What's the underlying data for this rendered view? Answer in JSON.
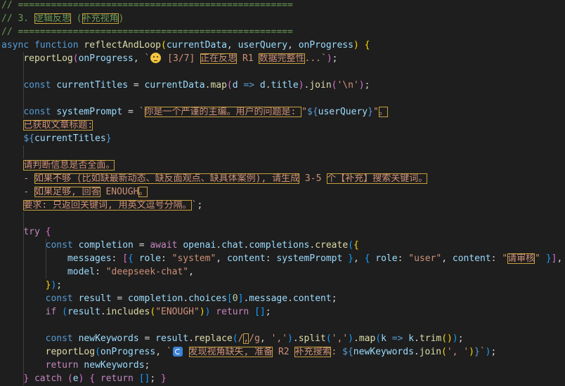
{
  "editor": {
    "lines": [
      [
        {
          "t": "// ==================================================",
          "c": "cm"
        }
      ],
      [
        {
          "t": "// 3. ",
          "c": "cm"
        },
        {
          "t": "逻辑反思",
          "c": "cm",
          "hl": 1
        },
        {
          "t": " (",
          "c": "cm"
        },
        {
          "t": "补充视角",
          "c": "cm",
          "hl": 1
        },
        {
          "t": ")",
          "c": "cm"
        }
      ],
      [
        {
          "t": "// ==================================================",
          "c": "cm"
        }
      ],
      [
        {
          "t": "async",
          "c": "kw"
        },
        {
          "t": " ",
          "c": "pu"
        },
        {
          "t": "function",
          "c": "kw"
        },
        {
          "t": " ",
          "c": "pu"
        },
        {
          "t": "reflectAndLoop",
          "c": "fn"
        },
        {
          "t": "(",
          "c": "br1"
        },
        {
          "t": "currentData",
          "c": "var"
        },
        {
          "t": ", ",
          "c": "pu"
        },
        {
          "t": "userQuery",
          "c": "var"
        },
        {
          "t": ", ",
          "c": "pu"
        },
        {
          "t": "onProgress",
          "c": "var"
        },
        {
          "t": ")",
          "c": "br1"
        },
        {
          "t": " ",
          "c": "pu"
        },
        {
          "t": "{",
          "c": "br1"
        }
      ],
      [
        {
          "t": "    ",
          "c": "pu"
        },
        {
          "t": "reportLog",
          "c": "fn"
        },
        {
          "t": "(",
          "c": "br2"
        },
        {
          "t": "onProgress",
          "c": "var"
        },
        {
          "t": ", ",
          "c": "pu"
        },
        {
          "t": "`",
          "c": "str"
        },
        {
          "icon": "thinking-face-emoji"
        },
        {
          "t": " [3/7] ",
          "c": "str"
        },
        {
          "t": "正在反思",
          "c": "str",
          "hl": 1
        },
        {
          "t": " R1 ",
          "c": "str"
        },
        {
          "t": "数据完整性",
          "c": "str",
          "hl": 1
        },
        {
          "t": "...`",
          "c": "str"
        },
        {
          "t": ")",
          "c": "br2"
        },
        {
          "t": ";",
          "c": "pu"
        }
      ],
      [],
      [
        {
          "t": "    ",
          "c": "pu"
        },
        {
          "t": "const",
          "c": "kw"
        },
        {
          "t": " ",
          "c": "pu"
        },
        {
          "t": "currentTitles",
          "c": "var"
        },
        {
          "t": " = ",
          "c": "pu"
        },
        {
          "t": "currentData",
          "c": "var"
        },
        {
          "t": ".",
          "c": "pu"
        },
        {
          "t": "map",
          "c": "fn"
        },
        {
          "t": "(",
          "c": "br2"
        },
        {
          "t": "d",
          "c": "var"
        },
        {
          "t": " ",
          "c": "pu"
        },
        {
          "t": "=>",
          "c": "kw"
        },
        {
          "t": " ",
          "c": "pu"
        },
        {
          "t": "d",
          "c": "var"
        },
        {
          "t": ".",
          "c": "pu"
        },
        {
          "t": "title",
          "c": "var"
        },
        {
          "t": ")",
          "c": "br2"
        },
        {
          "t": ".",
          "c": "pu"
        },
        {
          "t": "join",
          "c": "fn"
        },
        {
          "t": "(",
          "c": "br2"
        },
        {
          "t": "'\\n'",
          "c": "str"
        },
        {
          "t": ")",
          "c": "br2"
        },
        {
          "t": ";",
          "c": "pu"
        }
      ],
      [],
      [
        {
          "t": "    ",
          "c": "pu"
        },
        {
          "t": "const",
          "c": "kw"
        },
        {
          "t": " ",
          "c": "pu"
        },
        {
          "t": "systemPrompt",
          "c": "var"
        },
        {
          "t": " = ",
          "c": "pu"
        },
        {
          "t": "`",
          "c": "str"
        },
        {
          "t": "你是一个严谨的主编。用户的问题是: ",
          "c": "str",
          "hl": 1
        },
        {
          "t": "\"",
          "c": "str"
        },
        {
          "t": "${",
          "c": "ph"
        },
        {
          "t": "userQuery",
          "c": "var"
        },
        {
          "t": "}",
          "c": "ph"
        },
        {
          "t": "\"",
          "c": "str"
        },
        {
          "t": "。",
          "c": "str",
          "hl": 1
        }
      ],
      [
        {
          "t": "    ",
          "c": "pu"
        },
        {
          "t": "已获取文章标题:",
          "c": "str",
          "hl": 1
        }
      ],
      [
        {
          "t": "    ",
          "c": "pu"
        },
        {
          "t": "${",
          "c": "ph"
        },
        {
          "t": "currentTitles",
          "c": "var"
        },
        {
          "t": "}",
          "c": "ph"
        }
      ],
      [],
      [
        {
          "t": "    ",
          "c": "pu"
        },
        {
          "t": "请判断信息是否全面。",
          "c": "str",
          "hl": 1
        }
      ],
      [
        {
          "t": "    ",
          "c": "pu"
        },
        {
          "t": "- ",
          "c": "str"
        },
        {
          "t": "如果不够 (比如缺最新动态、缺反面观点、缺具体案例), 请生成",
          "c": "str",
          "hl": 1
        },
        {
          "t": " 3-5 ",
          "c": "str"
        },
        {
          "t": "个【补充】搜索关键词。",
          "c": "str",
          "hl": 1
        }
      ],
      [
        {
          "t": "    ",
          "c": "pu"
        },
        {
          "t": "- ",
          "c": "str"
        },
        {
          "t": "如果足够, 回答",
          "c": "str",
          "hl": 1
        },
        {
          "t": " ENOUGH",
          "c": "str"
        },
        {
          "t": "。",
          "c": "str",
          "hl": 1
        }
      ],
      [
        {
          "t": "    ",
          "c": "pu"
        },
        {
          "t": "要求: 只返回关键词, 用英文逗号分隔。",
          "c": "str",
          "hl": 1
        },
        {
          "t": "`",
          "c": "str"
        },
        {
          "t": ";",
          "c": "pu"
        }
      ],
      [],
      [
        {
          "t": "    ",
          "c": "pu"
        },
        {
          "t": "try",
          "c": "ctl"
        },
        {
          "t": " ",
          "c": "pu"
        },
        {
          "t": "{",
          "c": "br2"
        }
      ],
      [
        {
          "t": "        ",
          "c": "pu"
        },
        {
          "t": "const",
          "c": "kw"
        },
        {
          "t": " ",
          "c": "pu"
        },
        {
          "t": "completion",
          "c": "var"
        },
        {
          "t": " = ",
          "c": "pu"
        },
        {
          "t": "await",
          "c": "ctl"
        },
        {
          "t": " ",
          "c": "pu"
        },
        {
          "t": "openai",
          "c": "var"
        },
        {
          "t": ".",
          "c": "pu"
        },
        {
          "t": "chat",
          "c": "var"
        },
        {
          "t": ".",
          "c": "pu"
        },
        {
          "t": "completions",
          "c": "var"
        },
        {
          "t": ".",
          "c": "pu"
        },
        {
          "t": "create",
          "c": "fn"
        },
        {
          "t": "(",
          "c": "br3"
        },
        {
          "t": "{",
          "c": "br1"
        }
      ],
      [
        {
          "t": "            ",
          "c": "pu"
        },
        {
          "t": "messages",
          "c": "var"
        },
        {
          "t": ": ",
          "c": "pu"
        },
        {
          "t": "[",
          "c": "br2"
        },
        {
          "t": "{",
          "c": "br3"
        },
        {
          "t": " ",
          "c": "pu"
        },
        {
          "t": "role",
          "c": "var"
        },
        {
          "t": ": ",
          "c": "pu"
        },
        {
          "t": "\"system\"",
          "c": "str"
        },
        {
          "t": ", ",
          "c": "pu"
        },
        {
          "t": "content",
          "c": "var"
        },
        {
          "t": ": ",
          "c": "pu"
        },
        {
          "t": "systemPrompt",
          "c": "var"
        },
        {
          "t": " ",
          "c": "pu"
        },
        {
          "t": "}",
          "c": "br3"
        },
        {
          "t": ", ",
          "c": "pu"
        },
        {
          "t": "{",
          "c": "br3"
        },
        {
          "t": " ",
          "c": "pu"
        },
        {
          "t": "role",
          "c": "var"
        },
        {
          "t": ": ",
          "c": "pu"
        },
        {
          "t": "\"user\"",
          "c": "str"
        },
        {
          "t": ", ",
          "c": "pu"
        },
        {
          "t": "content",
          "c": "var"
        },
        {
          "t": ": ",
          "c": "pu"
        },
        {
          "t": "\"",
          "c": "str"
        },
        {
          "t": "请审核",
          "c": "str",
          "hl": 1
        },
        {
          "t": "\"",
          "c": "str"
        },
        {
          "t": " ",
          "c": "pu"
        },
        {
          "t": "}",
          "c": "br3"
        },
        {
          "t": "]",
          "c": "br2"
        },
        {
          "t": ",",
          "c": "pu"
        }
      ],
      [
        {
          "t": "            ",
          "c": "pu"
        },
        {
          "t": "model",
          "c": "var"
        },
        {
          "t": ": ",
          "c": "pu"
        },
        {
          "t": "\"deepseek-chat\"",
          "c": "str"
        },
        {
          "t": ",",
          "c": "pu"
        }
      ],
      [
        {
          "t": "        ",
          "c": "pu"
        },
        {
          "t": "}",
          "c": "br1"
        },
        {
          "t": ")",
          "c": "br3"
        },
        {
          "t": ";",
          "c": "pu"
        }
      ],
      [
        {
          "t": "        ",
          "c": "pu"
        },
        {
          "t": "const",
          "c": "kw"
        },
        {
          "t": " ",
          "c": "pu"
        },
        {
          "t": "result",
          "c": "var"
        },
        {
          "t": " = ",
          "c": "pu"
        },
        {
          "t": "completion",
          "c": "var"
        },
        {
          "t": ".",
          "c": "pu"
        },
        {
          "t": "choices",
          "c": "var"
        },
        {
          "t": "[",
          "c": "br3"
        },
        {
          "t": "0",
          "c": "num"
        },
        {
          "t": "]",
          "c": "br3"
        },
        {
          "t": ".",
          "c": "pu"
        },
        {
          "t": "message",
          "c": "var"
        },
        {
          "t": ".",
          "c": "pu"
        },
        {
          "t": "content",
          "c": "var"
        },
        {
          "t": ";",
          "c": "pu"
        }
      ],
      [
        {
          "t": "        ",
          "c": "pu"
        },
        {
          "t": "if",
          "c": "ctl"
        },
        {
          "t": " ",
          "c": "pu"
        },
        {
          "t": "(",
          "c": "br3"
        },
        {
          "t": "result",
          "c": "var"
        },
        {
          "t": ".",
          "c": "pu"
        },
        {
          "t": "includes",
          "c": "fn"
        },
        {
          "t": "(",
          "c": "br1"
        },
        {
          "t": "\"ENOUGH\"",
          "c": "str"
        },
        {
          "t": ")",
          "c": "br1"
        },
        {
          "t": ")",
          "c": "br3"
        },
        {
          "t": " ",
          "c": "pu"
        },
        {
          "t": "return",
          "c": "ctl"
        },
        {
          "t": " ",
          "c": "pu"
        },
        {
          "t": "[]",
          "c": "br3"
        },
        {
          "t": ";",
          "c": "pu"
        }
      ],
      [],
      [
        {
          "t": "        ",
          "c": "pu"
        },
        {
          "t": "const",
          "c": "kw"
        },
        {
          "t": " ",
          "c": "pu"
        },
        {
          "t": "newKeywords",
          "c": "var"
        },
        {
          "t": " = ",
          "c": "pu"
        },
        {
          "t": "result",
          "c": "var"
        },
        {
          "t": ".",
          "c": "pu"
        },
        {
          "t": "replace",
          "c": "fn"
        },
        {
          "t": "(",
          "c": "br3"
        },
        {
          "t": "/",
          "c": "str"
        },
        {
          "t": ",",
          "c": "str",
          "hl": 1
        },
        {
          "t": "/g",
          "c": "str"
        },
        {
          "t": ", ",
          "c": "pu"
        },
        {
          "t": "','",
          "c": "str"
        },
        {
          "t": ")",
          "c": "br3"
        },
        {
          "t": ".",
          "c": "pu"
        },
        {
          "t": "split",
          "c": "fn"
        },
        {
          "t": "(",
          "c": "br3"
        },
        {
          "t": "','",
          "c": "str"
        },
        {
          "t": ")",
          "c": "br3"
        },
        {
          "t": ".",
          "c": "pu"
        },
        {
          "t": "map",
          "c": "fn"
        },
        {
          "t": "(",
          "c": "br3"
        },
        {
          "t": "k",
          "c": "var"
        },
        {
          "t": " ",
          "c": "pu"
        },
        {
          "t": "=>",
          "c": "kw"
        },
        {
          "t": " ",
          "c": "pu"
        },
        {
          "t": "k",
          "c": "var"
        },
        {
          "t": ".",
          "c": "pu"
        },
        {
          "t": "trim",
          "c": "fn"
        },
        {
          "t": "()",
          "c": "br1"
        },
        {
          "t": ")",
          "c": "br3"
        },
        {
          "t": ";",
          "c": "pu"
        }
      ],
      [
        {
          "t": "        ",
          "c": "pu"
        },
        {
          "t": "reportLog",
          "c": "fn"
        },
        {
          "t": "(",
          "c": "br3"
        },
        {
          "t": "onProgress",
          "c": "var"
        },
        {
          "t": ", ",
          "c": "pu"
        },
        {
          "t": "`",
          "c": "str"
        },
        {
          "icon": "refresh-emoji"
        },
        {
          "t": " ",
          "c": "str"
        },
        {
          "t": "发现视角缺失, 准备",
          "c": "str",
          "hl": 1
        },
        {
          "t": " R2 ",
          "c": "str"
        },
        {
          "t": "补充搜索",
          "c": "str",
          "hl": 1
        },
        {
          "t": ": ",
          "c": "str"
        },
        {
          "t": "${",
          "c": "ph"
        },
        {
          "t": "newKeywords",
          "c": "var"
        },
        {
          "t": ".",
          "c": "pu"
        },
        {
          "t": "join",
          "c": "fn"
        },
        {
          "t": "(",
          "c": "br1"
        },
        {
          "t": "', '",
          "c": "str"
        },
        {
          "t": ")",
          "c": "br1"
        },
        {
          "t": "}",
          "c": "ph"
        },
        {
          "t": "`",
          "c": "str"
        },
        {
          "t": ")",
          "c": "br3"
        },
        {
          "t": ";",
          "c": "pu"
        }
      ],
      [
        {
          "t": "        ",
          "c": "pu"
        },
        {
          "t": "return",
          "c": "ctl"
        },
        {
          "t": " ",
          "c": "pu"
        },
        {
          "t": "newKeywords",
          "c": "var"
        },
        {
          "t": ";",
          "c": "pu"
        }
      ],
      [
        {
          "t": "    ",
          "c": "pu"
        },
        {
          "t": "}",
          "c": "br2"
        },
        {
          "t": " ",
          "c": "pu"
        },
        {
          "t": "catch",
          "c": "ctl"
        },
        {
          "t": " ",
          "c": "pu"
        },
        {
          "t": "(",
          "c": "br2"
        },
        {
          "t": "e",
          "c": "var"
        },
        {
          "t": ")",
          "c": "br2"
        },
        {
          "t": " ",
          "c": "pu"
        },
        {
          "t": "{",
          "c": "br2"
        },
        {
          "t": " ",
          "c": "pu"
        },
        {
          "t": "return",
          "c": "ctl"
        },
        {
          "t": " ",
          "c": "pu"
        },
        {
          "t": "[]",
          "c": "br3"
        },
        {
          "t": "; ",
          "c": "pu"
        },
        {
          "t": "}",
          "c": "br2"
        }
      ],
      [
        {
          "t": "}",
          "c": "br1"
        }
      ]
    ]
  },
  "guides": [
    {
      "line": 4,
      "cols": [
        4
      ]
    },
    {
      "line": 5,
      "cols": [
        4
      ]
    },
    {
      "line": 6,
      "cols": [
        4
      ]
    },
    {
      "line": 7,
      "cols": [
        4
      ]
    },
    {
      "line": 8,
      "cols": [
        4
      ]
    },
    {
      "line": 11,
      "cols": [
        4
      ]
    },
    {
      "line": 16,
      "cols": [
        4
      ]
    },
    {
      "line": 17,
      "cols": [
        4
      ]
    },
    {
      "line": 18,
      "cols": [
        4,
        8
      ]
    },
    {
      "line": 19,
      "cols": [
        4,
        8
      ]
    },
    {
      "line": 20,
      "cols": [
        4,
        8
      ]
    },
    {
      "line": 21,
      "cols": [
        4
      ]
    },
    {
      "line": 22,
      "cols": [
        4
      ]
    },
    {
      "line": 23,
      "cols": [
        4
      ]
    },
    {
      "line": 24,
      "cols": [
        4
      ]
    },
    {
      "line": 25,
      "cols": [
        4
      ]
    },
    {
      "line": 26,
      "cols": [
        4
      ]
    },
    {
      "line": 27,
      "cols": [
        4
      ]
    },
    {
      "line": 28,
      "cols": [
        4
      ]
    }
  ]
}
